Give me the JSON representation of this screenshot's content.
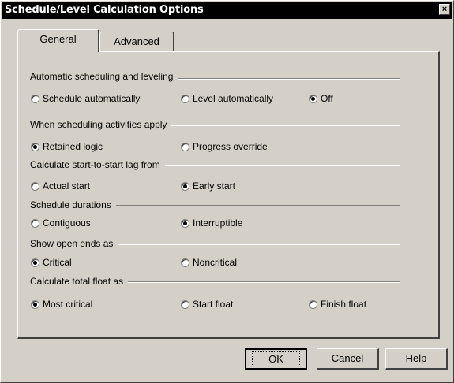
{
  "window": {
    "title": "Schedule/Level Calculation Options",
    "close_label": "×"
  },
  "tabs": [
    {
      "label": "General"
    },
    {
      "label": "Advanced"
    }
  ],
  "groups": {
    "auto": {
      "label": "Automatic scheduling and leveling",
      "options": [
        {
          "label": "Schedule automatically",
          "selected": false
        },
        {
          "label": "Level automatically",
          "selected": false
        },
        {
          "label": "Off",
          "selected": true
        }
      ]
    },
    "apply": {
      "label": "When scheduling activities apply",
      "options": [
        {
          "label": "Retained logic",
          "selected": true
        },
        {
          "label": "Progress override",
          "selected": false
        }
      ]
    },
    "lag": {
      "label": "Calculate start-to-start lag from",
      "options": [
        {
          "label": "Actual start",
          "selected": false
        },
        {
          "label": "Early start",
          "selected": true
        }
      ]
    },
    "durations": {
      "label": "Schedule durations",
      "options": [
        {
          "label": "Contiguous",
          "selected": false
        },
        {
          "label": "Interruptible",
          "selected": true
        }
      ]
    },
    "openends": {
      "label": "Show open ends as",
      "options": [
        {
          "label": "Critical",
          "selected": true
        },
        {
          "label": "Noncritical",
          "selected": false
        }
      ]
    },
    "float": {
      "label": "Calculate total float as",
      "options": [
        {
          "label": "Most critical",
          "selected": true
        },
        {
          "label": "Start float",
          "selected": false
        },
        {
          "label": "Finish float",
          "selected": false
        }
      ]
    }
  },
  "buttons": {
    "ok": "OK",
    "cancel": "Cancel",
    "help": "Help"
  }
}
